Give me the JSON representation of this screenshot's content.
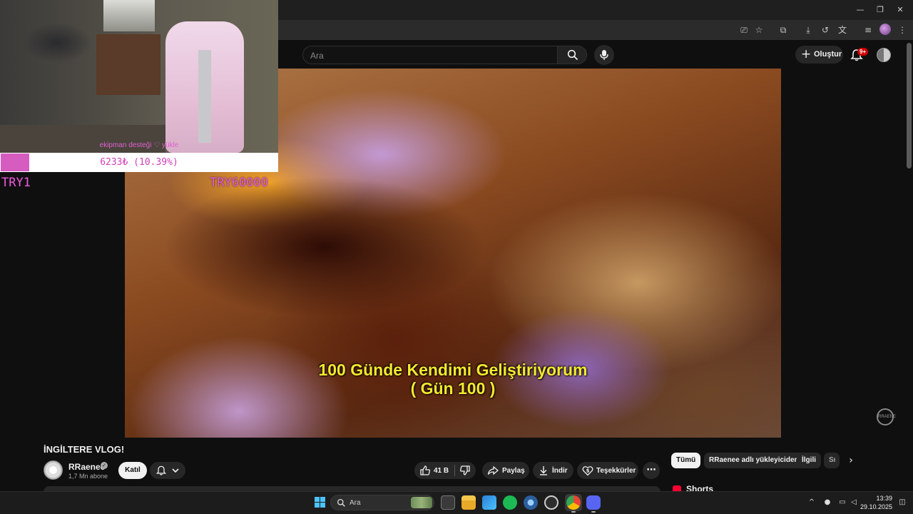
{
  "masthead": {
    "search_placeholder": "Ara",
    "create_label": "Oluştur",
    "notification_count": "9+"
  },
  "facecam": {
    "goal_title": "ekipman desteği ♡ yükle",
    "goal_progress_text": "6233₺ (10.39%)",
    "goal_fraction": 0.1039,
    "goal_min": "TRY1",
    "goal_max": "TRY60000"
  },
  "video": {
    "caption_line1": "100 Günde Kendimi Geliştiriyorum",
    "caption_line2": "( Gün 100 )",
    "title": "İNGİLTERE VLOG!",
    "watermark": "RRAENE"
  },
  "channel": {
    "name": "RRaenee",
    "subscribers": "1,7 Mn abone",
    "join_label": "Katıl"
  },
  "actions": {
    "like_count": "41 B",
    "share_label": "Paylaş",
    "download_label": "İndir",
    "thanks_label": "Teşekkürler",
    "more_label": "⋯"
  },
  "sidebar": {
    "chips": [
      "Tümü",
      "RRaenee adlı yükleyiciden",
      "İlgili",
      "Sı"
    ],
    "shorts_label": "Shorts"
  },
  "taskbar": {
    "search_placeholder": "Ara",
    "time": "13:39",
    "date": "29.10.2025"
  },
  "colors": {
    "accent_pink": "#d65cc0",
    "caption_yellow": "#f5e92e",
    "notification_red": "#cc0000",
    "shorts_red": "#ff0033"
  }
}
